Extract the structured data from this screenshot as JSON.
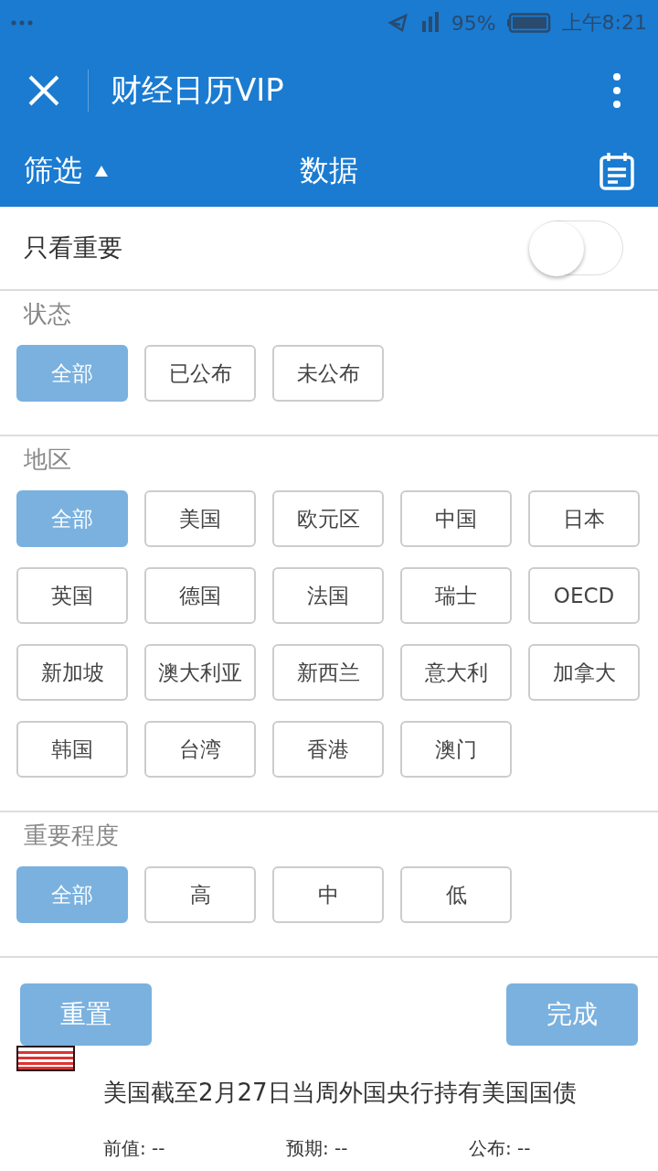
{
  "status_bar": {
    "battery": "95%",
    "time": "上午8:21"
  },
  "title_bar": {
    "title": "财经日历VIP"
  },
  "tab_bar": {
    "filter": "筛选",
    "center": "数据"
  },
  "important_only": {
    "label": "只看重要",
    "on": false
  },
  "sections": [
    {
      "title": "状态",
      "options": [
        {
          "label": "全部",
          "selected": true
        },
        {
          "label": "已公布",
          "selected": false
        },
        {
          "label": "未公布",
          "selected": false
        }
      ]
    },
    {
      "title": "地区",
      "options": [
        {
          "label": "全部",
          "selected": true
        },
        {
          "label": "美国",
          "selected": false
        },
        {
          "label": "欧元区",
          "selected": false
        },
        {
          "label": "中国",
          "selected": false
        },
        {
          "label": "日本",
          "selected": false
        },
        {
          "label": "英国",
          "selected": false
        },
        {
          "label": "德国",
          "selected": false
        },
        {
          "label": "法国",
          "selected": false
        },
        {
          "label": "瑞士",
          "selected": false
        },
        {
          "label": "OECD",
          "selected": false
        },
        {
          "label": "新加坡",
          "selected": false
        },
        {
          "label": "澳大利亚",
          "selected": false
        },
        {
          "label": "新西兰",
          "selected": false
        },
        {
          "label": "意大利",
          "selected": false
        },
        {
          "label": "加拿大",
          "selected": false
        },
        {
          "label": "韩国",
          "selected": false
        },
        {
          "label": "台湾",
          "selected": false
        },
        {
          "label": "香港",
          "selected": false
        },
        {
          "label": "澳门",
          "selected": false
        }
      ]
    },
    {
      "title": "重要程度",
      "options": [
        {
          "label": "全部",
          "selected": true
        },
        {
          "label": "高",
          "selected": false
        },
        {
          "label": "中",
          "selected": false
        },
        {
          "label": "低",
          "selected": false
        }
      ]
    }
  ],
  "actions": {
    "reset": "重置",
    "done": "完成"
  },
  "event": {
    "title": "美国截至2月27日当周外国央行持有美国国债",
    "fields": [
      "前值: --",
      "预期: --",
      "公布: --"
    ]
  }
}
